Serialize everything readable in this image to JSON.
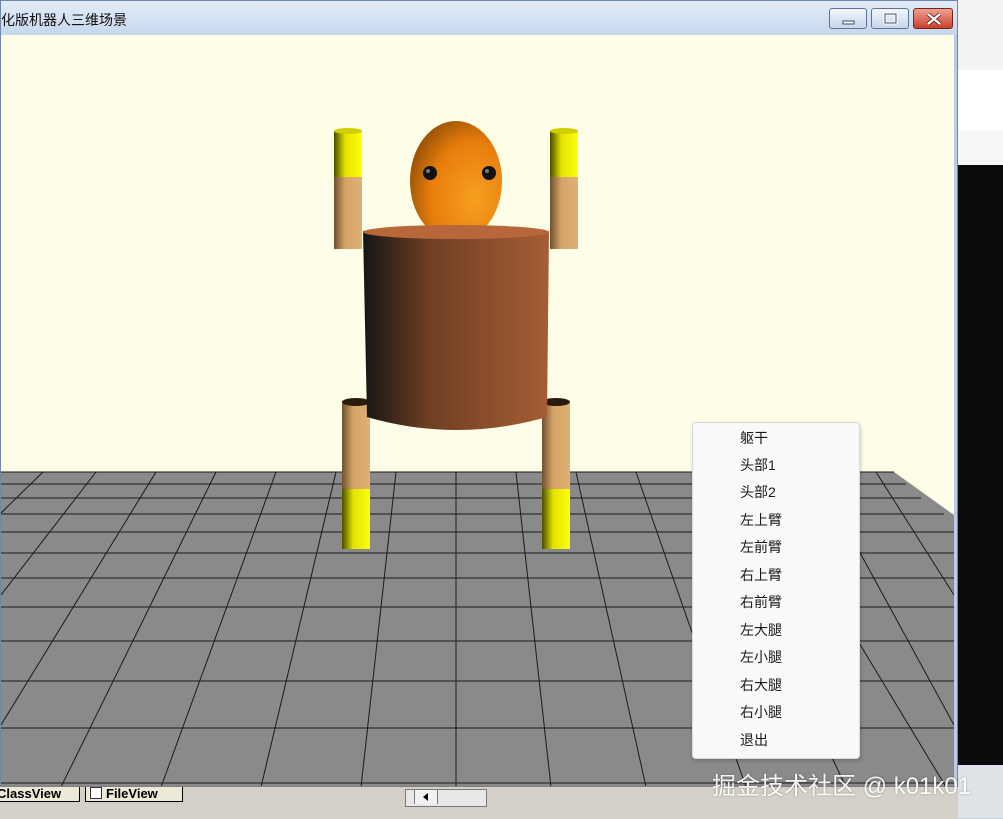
{
  "window": {
    "title": "化版机器人三维场景"
  },
  "icons": [
    "minimize-icon",
    "maximize-icon",
    "close-icon",
    "fileview-icon",
    "scroll-left-icon"
  ],
  "colors": {
    "viewport_background": "#fdfde8",
    "floor": "#8a8a8a",
    "body": "#9a5a35",
    "head": "#f08a10",
    "limb_skin": "#d9a466",
    "limb_end": "#e8e800"
  },
  "context_menu": {
    "items": [
      "躯干",
      "头部1",
      "头部2",
      "左上臂",
      "左前臂",
      "右上臂",
      "右前臂",
      "左大腿",
      "左小腿",
      "右大腿",
      "右小腿",
      "退出"
    ]
  },
  "tabs": {
    "classview": "ClassView",
    "fileview": "FileView"
  },
  "watermark": "掘金技术社区 @ k01k01"
}
